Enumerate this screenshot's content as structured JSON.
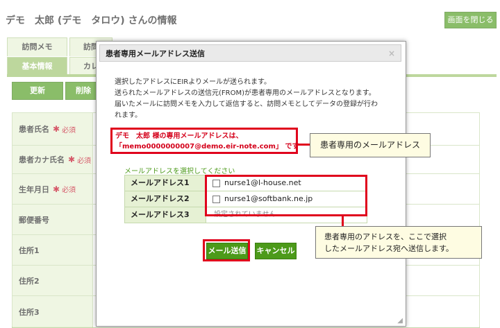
{
  "page": {
    "title": "デモ　太郎 (デモ　タロウ) さんの情報",
    "close_label": "画面を閉じる",
    "tabs_row1": [
      "訪問メモ",
      "訪問"
    ],
    "tabs_row2": [
      "基本情報",
      "カレ"
    ],
    "update_label": "更新",
    "delete_label": "削除"
  },
  "form": {
    "required_mark": "必須",
    "rows": [
      {
        "label": "患者氏名",
        "required": true
      },
      {
        "label": "患者カナ氏名",
        "required": true
      },
      {
        "label": "生年月日",
        "required": true
      },
      {
        "label": "郵便番号",
        "required": false
      },
      {
        "label": "住所1",
        "required": false
      },
      {
        "label": "住所2",
        "required": false
      },
      {
        "label": "住所3",
        "required": false
      }
    ]
  },
  "modal": {
    "title": "患者専用メールアドレス送信",
    "close_glyph": "×",
    "intro_lines": [
      "選択したアドレスにEIRよりメールが送られます。",
      "送られたメールアドレスの送信元(FROM)が患者専用のメールアドレスとなります。",
      "届いたメールに訪問メモを入力して返信すると、訪問メモとしてデータの登録が行わ",
      "れます。"
    ],
    "dedicated_line1": "デモ　太郎 様の専用メールアドレスは、",
    "dedicated_line2": "「memo0000000007@demo.eir-note.com」 です",
    "select_prompt": "メールアドレスを選択してください",
    "addresses": [
      {
        "label": "メールアドレス1",
        "value": "nurse1@l-house.net",
        "checked": false
      },
      {
        "label": "メールアドレス2",
        "value": "nurse1@softbank.ne.jp",
        "checked": false
      },
      {
        "label": "メールアドレス3",
        "value": "設定されていません",
        "checked": null
      }
    ],
    "send_label": "メール送信",
    "cancel_label": "キャンセル"
  },
  "callouts": {
    "dedicated": "患者専用のメールアドレス",
    "send_line1": "患者専用のアドレスを、ここで選択",
    "send_line2": "したメールアドレス宛へ送信します。"
  },
  "colors": {
    "accent": "#4c9a1a",
    "highlight": "#e0001c",
    "callout_bg": "#fefce2"
  }
}
